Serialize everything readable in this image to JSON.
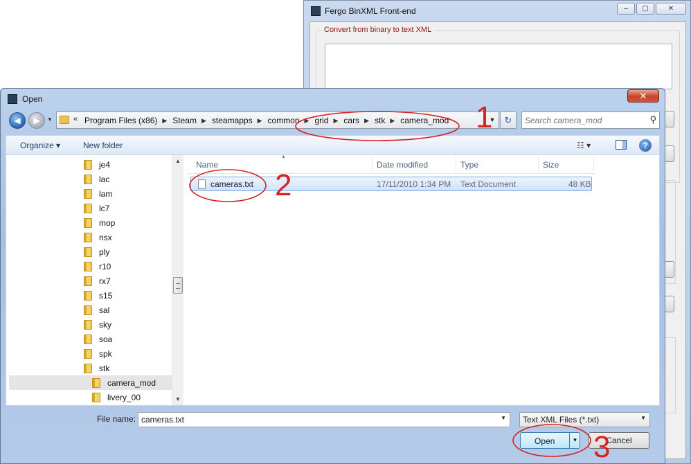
{
  "background_window": {
    "title": "Fergo BinXML Front-end",
    "group_label": "Convert from binary to text XML",
    "minimize_glyph": "–",
    "maximize_glyph": "▢",
    "close_glyph": "✕"
  },
  "dialog": {
    "title": "Open",
    "close_glyph": "✕",
    "nav": {
      "back_glyph": "◀",
      "forward_glyph": "▶",
      "dropdown_glyph": "▼"
    },
    "address": {
      "overflow": "«",
      "crumbs": [
        "Program Files (x86)",
        "Steam",
        "steamapps",
        "common",
        "grid",
        "cars",
        "stk",
        "camera_mod"
      ],
      "separator": "▶",
      "dropdown_glyph": "▼"
    },
    "refresh_glyph": "↻",
    "search": {
      "placeholder": "Search camera_mod",
      "icon": "search-icon",
      "icon_glyph": "⚲"
    },
    "toolbar": {
      "organize_label": "Organize ▾",
      "new_folder_label": "New folder",
      "views_glyph": "☷ ▾",
      "help_glyph": "?"
    },
    "tree": [
      {
        "label": "je4",
        "level": 0
      },
      {
        "label": "lac",
        "level": 0
      },
      {
        "label": "lam",
        "level": 0
      },
      {
        "label": "lc7",
        "level": 0
      },
      {
        "label": "mop",
        "level": 0
      },
      {
        "label": "nsx",
        "level": 0
      },
      {
        "label": "ply",
        "level": 0
      },
      {
        "label": "r10",
        "level": 0
      },
      {
        "label": "rx7",
        "level": 0
      },
      {
        "label": "s15",
        "level": 0
      },
      {
        "label": "sal",
        "level": 0
      },
      {
        "label": "sky",
        "level": 0
      },
      {
        "label": "soa",
        "level": 0
      },
      {
        "label": "spk",
        "level": 0
      },
      {
        "label": "stk",
        "level": 0
      },
      {
        "label": "camera_mod",
        "level": 1,
        "selected": true
      },
      {
        "label": "livery_00",
        "level": 1
      }
    ],
    "scroll": {
      "up_glyph": "▲",
      "down_glyph": "▼"
    },
    "columns": [
      "Name",
      "Date modified",
      "Type",
      "Size"
    ],
    "sort_glyph": "▲",
    "files": [
      {
        "name": "cameras.txt",
        "date_modified": "17/11/2010 1:34 PM",
        "type": "Text Document",
        "size": "48 KB"
      }
    ],
    "file_name_label": "File name:",
    "file_name_value": "cameras.txt",
    "file_type_value": "Text XML Files (*.txt)",
    "select_glyph": "▼",
    "open_label": "Open",
    "open_split_glyph": "▼",
    "cancel_label": "Cancel"
  },
  "annotations": {
    "labels": [
      "1",
      "2",
      "3"
    ],
    "color": "#d92121"
  },
  "colors": {
    "selection_row": "#cfe3fc",
    "frame": "#a6c0e3",
    "close_red": "#c7432a"
  }
}
